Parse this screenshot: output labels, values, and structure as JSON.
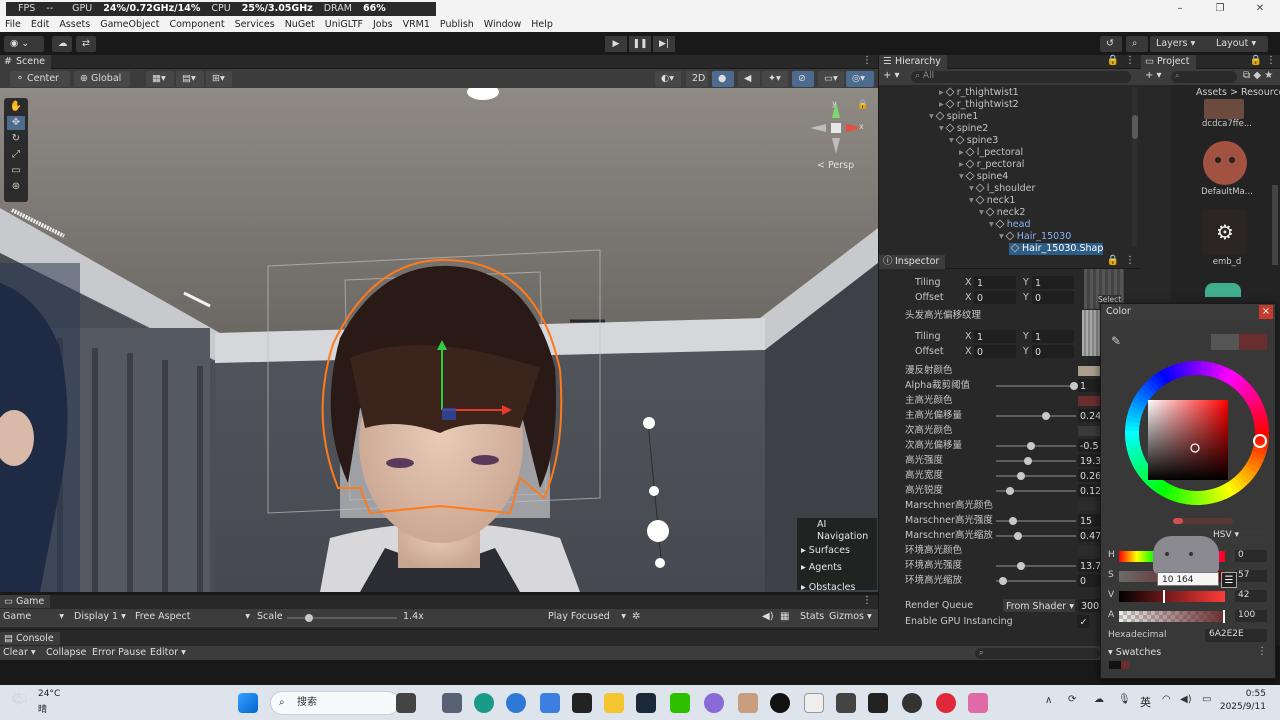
{
  "perf": {
    "fps_label": "FPS",
    "fps_value": "--",
    "gpu_label": "GPU",
    "gpu_value": "24%/0.72GHz/14%",
    "cpu_label": "CPU",
    "cpu_value": "25%/3.05GHz",
    "dram_label": "DRAM",
    "dram_value": "66%"
  },
  "menu": [
    "File",
    "Edit",
    "Assets",
    "GameObject",
    "Component",
    "Services",
    "NuGet",
    "UniGLTF",
    "Jobs",
    "VRM1",
    "Publish",
    "Window",
    "Help"
  ],
  "toolbar": {
    "layers": "Layers",
    "layout": "Layout"
  },
  "scene": {
    "tab": "Scene",
    "pivot": "Center",
    "space": "Global",
    "mode2d": "2D",
    "persp": "< Persp",
    "gizmo_x": "x",
    "gizmo_y": "y"
  },
  "ai_nav": {
    "title": "AI Navigation",
    "items": [
      "Surfaces",
      "Agents",
      "Obstacles"
    ]
  },
  "game": {
    "tab": "Game",
    "display_mode": "Game",
    "display": "Display 1",
    "aspect": "Free Aspect",
    "scale_label": "Scale",
    "scale_value": "1.4x",
    "play_mode": "Play Focused",
    "stats": "Stats",
    "gizmos": "Gizmos"
  },
  "console": {
    "tab": "Console",
    "clear": "Clear",
    "collapse": "Collapse",
    "error_pause": "Error Pause",
    "editor": "Editor"
  },
  "hierarchy": {
    "tab": "Hierarchy",
    "search_placeholder": "All",
    "items": [
      {
        "name": "r_thightwist1",
        "depth": 3
      },
      {
        "name": "r_thightwist2",
        "depth": 3
      },
      {
        "name": "spine1",
        "depth": 2
      },
      {
        "name": "spine2",
        "depth": 3
      },
      {
        "name": "spine3",
        "depth": 4
      },
      {
        "name": "l_pectoral",
        "depth": 5
      },
      {
        "name": "r_pectoral",
        "depth": 5
      },
      {
        "name": "spine4",
        "depth": 5
      },
      {
        "name": "l_shoulder",
        "depth": 6
      },
      {
        "name": "neck1",
        "depth": 6
      },
      {
        "name": "neck2",
        "depth": 7
      },
      {
        "name": "head",
        "depth": 8
      },
      {
        "name": "Hair_15030",
        "depth": 9
      },
      {
        "name": "Hair_15030.Shap",
        "depth": 10
      }
    ]
  },
  "project": {
    "tab": "Project",
    "breadcrumb_assets": "Assets",
    "breadcrumb_sep": ">",
    "breadcrumb_resources": "Resources",
    "items": [
      "dcdca7ffe...",
      "DefaultMa...",
      "emb_d"
    ]
  },
  "inspector": {
    "tab": "Inspector",
    "tiling_label": "Tiling",
    "offset_label": "Offset",
    "x": "X",
    "y": "Y",
    "tiling1": {
      "x": "1",
      "y": "1"
    },
    "offset1": {
      "x": "0",
      "y": "0"
    },
    "tex2_label": "头发高光偏移纹理",
    "tiling2": {
      "x": "1",
      "y": "1"
    },
    "offset2": {
      "x": "0",
      "y": "0"
    },
    "select": "Select",
    "props": [
      {
        "label": "漫反射颜色",
        "type": "color",
        "color": "#a8a08c"
      },
      {
        "label": "Alpha裁剪阈值",
        "type": "slider",
        "value": "1",
        "pos": 1.0
      },
      {
        "label": "主高光颜色",
        "type": "color",
        "color": "#6a2e2e"
      },
      {
        "label": "主高光偏移量",
        "type": "slider",
        "value": "0.24",
        "pos": 0.62
      },
      {
        "label": "次高光颜色",
        "type": "color",
        "color": "#3a3a3a"
      },
      {
        "label": "次高光偏移量",
        "type": "slider",
        "value": "-0.5",
        "pos": 0.42
      },
      {
        "label": "高光强度",
        "type": "slider",
        "value": "19.3",
        "pos": 0.38
      },
      {
        "label": "高光宽度",
        "type": "slider",
        "value": "0.26",
        "pos": 0.28
      },
      {
        "label": "高光锐度",
        "type": "slider",
        "value": "0.12",
        "pos": 0.14
      },
      {
        "label": "Marschner高光颜色",
        "type": "color",
        "color": "#2c2c2c"
      },
      {
        "label": "Marschner高光强度",
        "type": "slider",
        "value": "15",
        "pos": 0.18
      },
      {
        "label": "Marschner高光缩放",
        "type": "slider",
        "value": "0.47",
        "pos": 0.24
      },
      {
        "label": "环境高光颜色",
        "type": "color",
        "color": "#2c2c2c"
      },
      {
        "label": "环境高光强度",
        "type": "slider",
        "value": "13.7",
        "pos": 0.28
      },
      {
        "label": "环境高光缩放",
        "type": "slider",
        "value": "0",
        "pos": 0.04
      }
    ],
    "render_queue_label": "Render Queue",
    "render_queue_mode": "From Shader",
    "render_queue_value": "300",
    "gpu_instancing_label": "Enable GPU Instancing",
    "gpu_instancing_checked": "✓"
  },
  "color_picker": {
    "title": "Color",
    "close": "×",
    "mode": "HSV",
    "h_label": "H",
    "h_value": "0",
    "s_label": "S",
    "s_value": "57",
    "s_tooltip": "10 164",
    "v_label": "V",
    "v_value": "42",
    "a_label": "A",
    "a_value": "100",
    "hex_label": "Hexadecimal",
    "hex_value": "6A2E2E",
    "swatches": "Swatches",
    "prev_color": "#555555",
    "current_color": "#6a2e2e"
  },
  "taskbar": {
    "temp": "24°C",
    "weather": "晴",
    "search": "搜索",
    "ime": "英",
    "time": "0:55",
    "date": "2025/9/11"
  }
}
